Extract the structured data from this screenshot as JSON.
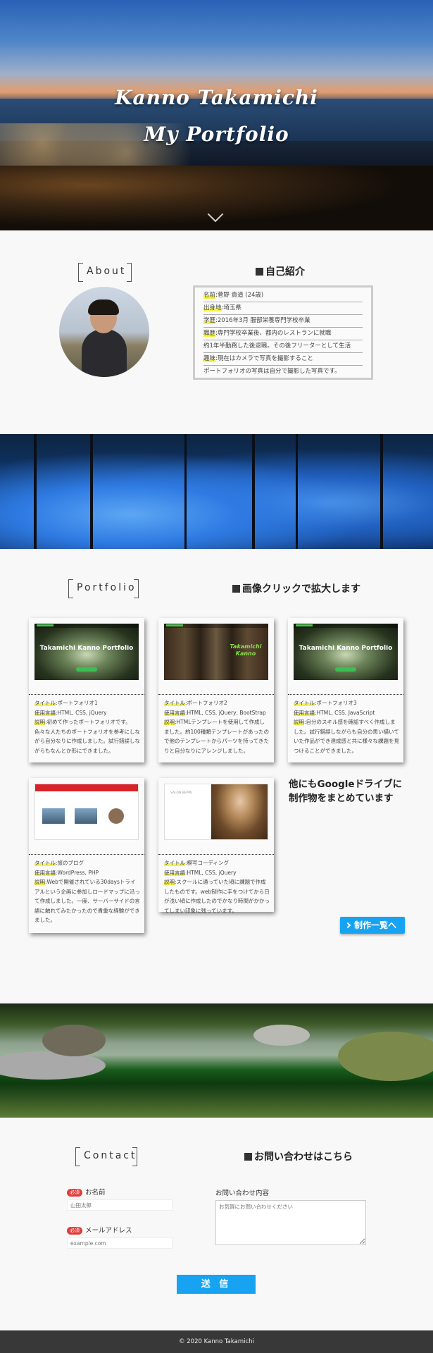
{
  "hero": {
    "title_line1": "Kanno Takamichi",
    "title_line2": "My Portfolio"
  },
  "about": {
    "label": "About",
    "heading": "自己紹介",
    "rows": [
      {
        "key": "名前",
        "value": "菅野 貴道 (24歳)"
      },
      {
        "key": "出身地",
        "value": "埼玉県"
      },
      {
        "key": "学歴",
        "value": "2016年3月 服部栄養専門学校卒業"
      },
      {
        "key": "職歴",
        "value": "専門学校卒業後、都内のレストランに就職"
      },
      {
        "key": "",
        "value": "約1年半勤務した後退職。その後フリーターとして生活"
      },
      {
        "key": "趣味",
        "value": "現在はカメラで写真を撮影すること"
      },
      {
        "key": "",
        "value": "ポートフォリオの写真は自分で撮影した写真です。"
      }
    ]
  },
  "portfolio": {
    "label": "Portfolio",
    "heading": "画像クリックで拡大します",
    "cards": [
      {
        "shot_title": "Takamichi Kanno Portfolio",
        "title_key": "タイトル",
        "title": "ポートフォリオ1",
        "lang_key": "使用言語",
        "lang": "HTML, CSS, jQuery",
        "desc_key": "説明",
        "desc": "初めて作ったポートフォリオです。色々な人たちのポートフォリオを参考にしながら自分なりに作成しました。試行錯誤しながらもなんとか形にできました。"
      },
      {
        "shot_title": "Takamichi Kanno",
        "title_key": "タイトル",
        "title": "ポートフォリオ2",
        "lang_key": "使用言語",
        "lang": "HTML, CSS, jQuery, BootStrap",
        "desc_key": "説明",
        "desc": "HTMLテンプレートを使用して作成しました。約100種類テンプレートがあったので他のテンプレートからパーツを持ってきたりと自分なりにアレンジしました。"
      },
      {
        "shot_title": "Takamichi Kanno Portfolio",
        "title_key": "タイトル",
        "title": "ポートフォリオ3",
        "lang_key": "使用言語",
        "lang": "HTML, CSS, JavaScript",
        "desc_key": "説明",
        "desc": "自分のスキル感を確認すべく作成しました。試行錯誤しながらも自分の思い描いていた作品ができ達成感と共に様々な課題を見つけることができました。"
      },
      {
        "shot_title": "",
        "title_key": "タイトル",
        "title": "旅のブログ",
        "lang_key": "使用言語",
        "lang": "WordPress, PHP",
        "desc_key": "説明",
        "desc": "Webで開催されている30daysトライアルという企画に参加しロードマップに沿って作成しました。一度、サーバーサイドの言語に触れてみたかったので貴重な経験ができました。"
      },
      {
        "shot_title": "SALON BEPPU",
        "title_key": "タイトル",
        "title": "模写コーディング",
        "lang_key": "使用言語",
        "lang": "HTML, CSS, jQuery",
        "desc_key": "説明",
        "desc": "スクールに通っていた頃に課題で作成したものです。web制作に手をつけてから日が浅い頃に作成したのでかなり時間がかかってしまい印象に残っています。"
      }
    ],
    "gdrive_text": "他にもGoogleドライブに制作物をまとめています",
    "list_button": "制作一覧へ"
  },
  "contact": {
    "label": "Contact",
    "heading": "お問い合わせはこちら",
    "required": "必須",
    "name_label": "お名前",
    "name_placeholder": "山田太郎",
    "email_label": "メールアドレス",
    "email_placeholder": "example.com",
    "message_label": "お問い合わせ内容",
    "message_placeholder": "お気軽にお問い合わせください",
    "submit": "送 信"
  },
  "footer": {
    "copyright": "© 2020 Kanno Takamichi"
  }
}
